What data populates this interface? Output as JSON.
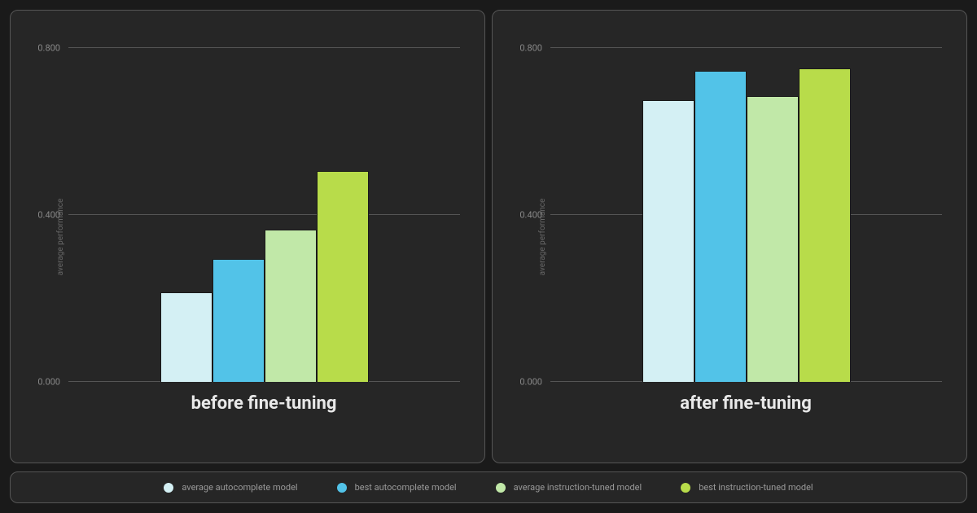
{
  "chart_data": [
    {
      "type": "bar",
      "title": "before fine-tuning",
      "ylabel": "average performance",
      "ylim": [
        0,
        0.85
      ],
      "ticks": [
        0.0,
        0.4,
        0.8
      ],
      "series": [
        {
          "name": "average autocomplete model",
          "value": 0.215,
          "color": "#d4f0f4"
        },
        {
          "name": "best autocomplete model",
          "value": 0.295,
          "color": "#52c3e8"
        },
        {
          "name": "average instruction-tuned model",
          "value": 0.365,
          "color": "#c1e8a8"
        },
        {
          "name": "best instruction-tuned model",
          "value": 0.505,
          "color": "#b8dc4a"
        }
      ]
    },
    {
      "type": "bar",
      "title": "after fine-tuning",
      "ylabel": "average performance",
      "ylim": [
        0,
        0.85
      ],
      "ticks": [
        0.0,
        0.4,
        0.8
      ],
      "series": [
        {
          "name": "average autocomplete model",
          "value": 0.675,
          "color": "#d4f0f4"
        },
        {
          "name": "best autocomplete model",
          "value": 0.745,
          "color": "#52c3e8"
        },
        {
          "name": "average instruction-tuned model",
          "value": 0.685,
          "color": "#c1e8a8"
        },
        {
          "name": "best instruction-tuned model",
          "value": 0.75,
          "color": "#b8dc4a"
        }
      ]
    }
  ],
  "legend": [
    {
      "label": "average autocomplete model",
      "color": "#d4f0f4"
    },
    {
      "label": "best autocomplete model",
      "color": "#52c3e8"
    },
    {
      "label": "average instruction-tuned model",
      "color": "#c1e8a8"
    },
    {
      "label": "best instruction-tuned model",
      "color": "#b8dc4a"
    }
  ],
  "tick_format": [
    "0.000",
    "0.400",
    "0.800"
  ]
}
